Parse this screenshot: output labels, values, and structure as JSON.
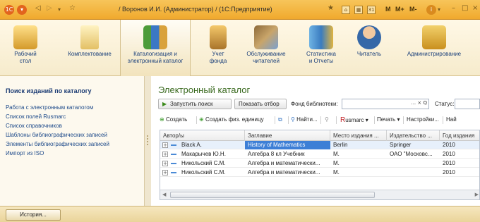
{
  "titlebar": {
    "title": "/ Воронов И.И. (Администратор) / (1С:Предприятие)",
    "memory_buttons": [
      "M",
      "M+",
      "M-"
    ]
  },
  "sections": [
    {
      "label": "Рабочий\nстол",
      "icon": "desk-icon"
    },
    {
      "label": "Комплектование",
      "icon": "shopping-bag-icon"
    },
    {
      "label": "Каталогизация и\nэлектронный каталог",
      "icon": "binders-icon",
      "active": true
    },
    {
      "label": "Учет\nфонда",
      "icon": "book-icon"
    },
    {
      "label": "Обслуживание\nчитателей",
      "icon": "tools-icon"
    },
    {
      "label": "Статистика\nи Отчеты",
      "icon": "database-icon"
    },
    {
      "label": "Читатель",
      "icon": "user-icon"
    },
    {
      "label": "Администрирование",
      "icon": "admin-icon"
    }
  ],
  "left_panel": {
    "title": "Поиск изданий по каталогу",
    "items": [
      "Работа с электронным каталогом",
      "Список полей Rusmarc",
      "Список справочников",
      "Шаблоны библиографических записей",
      "Элементы библиографических записей",
      "Импорт из ISO"
    ]
  },
  "main": {
    "title": "Электронный каталог",
    "run_search": "Запустить поиск",
    "show_selection": "Показать отбор",
    "library_fund_label": "Фонд библиотеки:",
    "library_fund_value": "",
    "library_fund_buttons": "... × Q",
    "status_label": "Статус:",
    "toolbar": {
      "create": "Создать",
      "create_phys": "Создать физ. единицу",
      "find": "Найти...",
      "rusmarc": "usmarc",
      "rusmarc_prefix": "R",
      "print": "Печать",
      "settings": "Настройки...",
      "find2": "Най"
    },
    "columns": [
      "Автор/ы",
      "Заглавие",
      "Место издания ...",
      "Издательство ...",
      "Год издания"
    ],
    "rows": [
      [
        "Black A.",
        "History of Mathematics",
        "Berlin",
        "Springer",
        "2010"
      ],
      [
        "Макарычев Ю.Н.",
        "Алгебра 8 кл Учебник",
        "М.",
        "ОАО \"Московс...",
        "2010"
      ],
      [
        "Никольский С.М.",
        "Алгебра и математически...",
        "М.",
        "",
        "2010"
      ],
      [
        "Никольский С.М.",
        "Алгебра и математически...",
        "М.",
        "",
        "2010"
      ]
    ]
  },
  "footer": {
    "history_button": "История..."
  },
  "colors": {
    "title_bar": "#f0a92d",
    "catalog_title": "#3a6a1f",
    "link": "#1d4a8a",
    "selected_cell": "#3d7fd6"
  }
}
